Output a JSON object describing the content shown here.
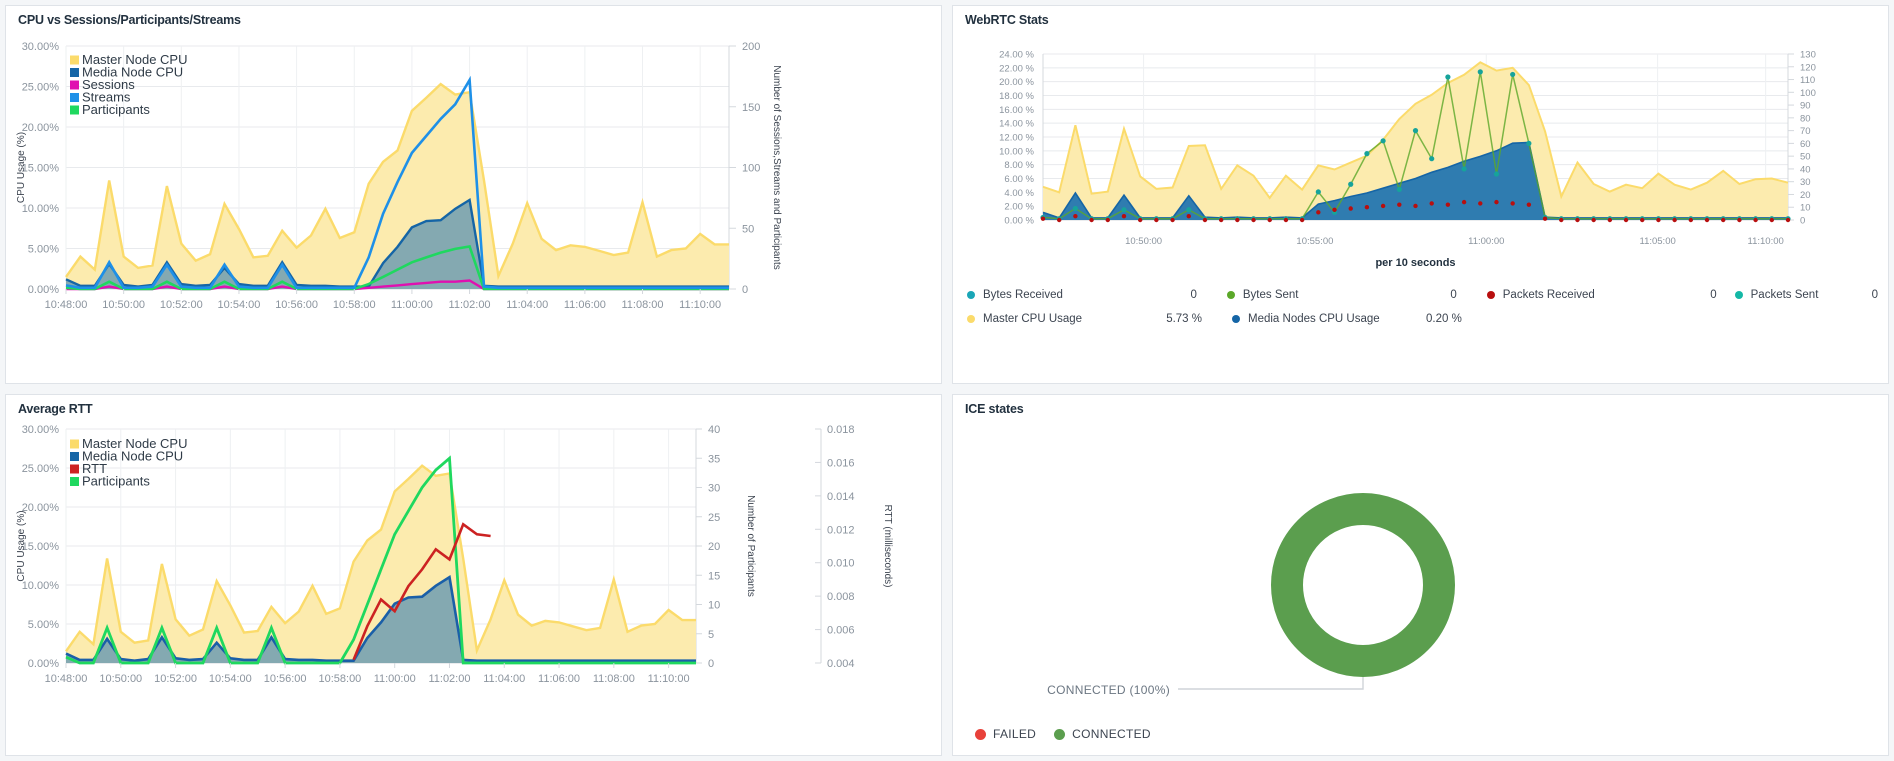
{
  "panels": {
    "cpu_sessions": {
      "title": "CPU vs Sessions/Participants/Streams"
    },
    "webrtc": {
      "title": "WebRTC Stats"
    },
    "avg_rtt": {
      "title": "Average RTT"
    },
    "ice": {
      "title": "ICE states"
    }
  },
  "colors": {
    "master_cpu": "#FBDB6B",
    "master_cpu_fill": "#FCEBAE",
    "media_cpu": "#1565A6",
    "media_cpu_fill": "#6E9EB2",
    "sessions": "#E010B0",
    "streams": "#1E90E8",
    "participants": "#1FD85F",
    "rtt": "#CC2222",
    "bytes_received": "#1AA6B7",
    "bytes_sent": "#5BA829",
    "packets_received": "#B80F0F",
    "packets_sent": "#14B8A6",
    "webrtc_master": "#FBDB6B",
    "webrtc_media": "#1565A6",
    "ice_failed": "#E8413A",
    "ice_connected": "#5B9E4E"
  },
  "chart_data": [
    {
      "id": "cpu_sessions",
      "type": "area",
      "title": "CPU vs Sessions/Participants/Streams",
      "xlabel": "",
      "ylabel": "CPU Usage (%)",
      "y2label": "Number of Sessions,Streams and Participants",
      "ylim": [
        0,
        30
      ],
      "y2lim": [
        0,
        200
      ],
      "yticks": [
        "0.00%",
        "5.00%",
        "10.00%",
        "15.00%",
        "20.00%",
        "25.00%",
        "30.00%"
      ],
      "y2ticks": [
        "0",
        "50",
        "100",
        "150",
        "200"
      ],
      "xticks": [
        "10:48:00",
        "10:50:00",
        "10:52:00",
        "10:54:00",
        "10:56:00",
        "10:58:00",
        "11:00:00",
        "11:02:00",
        "11:04:00",
        "11:06:00",
        "11:08:00",
        "11:10:00"
      ],
      "legend": [
        {
          "label": "Master Node CPU",
          "color": "#FBDB6B"
        },
        {
          "label": "Media Node CPU",
          "color": "#1565A6"
        },
        {
          "label": "Sessions",
          "color": "#E010B0"
        },
        {
          "label": "Streams",
          "color": "#1E90E8"
        },
        {
          "label": "Participants",
          "color": "#1FD85F"
        }
      ],
      "series": [
        {
          "name": "Master Node CPU",
          "axis": "left",
          "values": [
            1.5,
            4.0,
            2.4,
            13.4,
            4.0,
            2.6,
            2.9,
            12.7,
            5.6,
            3.5,
            4.3,
            10.5,
            7.4,
            3.9,
            4.1,
            7.2,
            5.1,
            6.6,
            9.9,
            6.3,
            7.0,
            13.0,
            15.7,
            17.1,
            22.0,
            23.6,
            25.3,
            24.0,
            24.3,
            13.4,
            1.6,
            5.6,
            10.6,
            6.2,
            4.8,
            5.4,
            5.2,
            4.7,
            4.2,
            4.5,
            10.7,
            4.0,
            4.8,
            5.0,
            6.8,
            5.5,
            5.5
          ]
        },
        {
          "name": "Media Node CPU",
          "axis": "left",
          "values": [
            1.2,
            0.4,
            0.4,
            3.1,
            0.5,
            0.3,
            0.5,
            3.3,
            0.6,
            0.4,
            0.5,
            2.6,
            0.6,
            0.4,
            0.4,
            3.3,
            0.5,
            0.4,
            0.4,
            0.3,
            0.3,
            0.3,
            3.2,
            5.2,
            7.6,
            8.4,
            8.5,
            9.9,
            11.0,
            0.4,
            0.3,
            0.3,
            0.3,
            0.3,
            0.3,
            0.3,
            0.3,
            0.3,
            0.3,
            0.3,
            0.3,
            0.3,
            0.3,
            0.3,
            0.3,
            0.3,
            0.3
          ]
        },
        {
          "name": "Sessions",
          "axis": "right",
          "values": [
            0,
            0,
            0,
            2,
            0,
            0,
            0,
            2,
            0,
            0,
            0,
            2,
            0,
            0,
            0,
            2,
            0,
            0,
            0,
            0,
            0,
            1,
            2,
            3,
            4,
            5,
            6,
            6,
            7,
            0,
            0,
            0,
            0,
            0,
            0,
            0,
            0,
            0,
            0,
            0,
            0,
            0,
            0,
            0,
            0,
            0,
            0
          ]
        },
        {
          "name": "Streams",
          "axis": "right",
          "values": [
            3,
            1,
            1,
            22,
            1,
            1,
            2,
            20,
            2,
            1,
            1,
            20,
            2,
            1,
            1,
            20,
            1,
            1,
            1,
            1,
            1,
            26,
            62,
            88,
            112,
            126,
            140,
            152,
            172,
            2,
            1,
            1,
            1,
            1,
            1,
            1,
            1,
            1,
            1,
            1,
            1,
            1,
            1,
            1,
            1,
            1,
            1
          ]
        },
        {
          "name": "Participants",
          "axis": "right",
          "values": [
            1,
            0,
            0,
            6,
            0,
            0,
            0,
            6,
            0,
            0,
            0,
            6,
            0,
            0,
            0,
            6,
            0,
            0,
            0,
            0,
            0,
            4,
            10,
            16,
            22,
            26,
            30,
            33,
            35,
            0,
            0,
            0,
            0,
            0,
            0,
            0,
            0,
            0,
            0,
            0,
            0,
            0,
            0,
            0,
            0,
            0,
            0
          ]
        }
      ]
    },
    {
      "id": "webrtc",
      "type": "area",
      "title": "WebRTC Stats",
      "xlabel": "per 10 seconds",
      "ylabel": "",
      "ylim": [
        0,
        24
      ],
      "y2lim": [
        0,
        130
      ],
      "yticks": [
        "0.00 %",
        "2.00 %",
        "4.00 %",
        "6.00 %",
        "8.00 %",
        "10.00 %",
        "12.00 %",
        "14.00 %",
        "16.00 %",
        "18.00 %",
        "20.00 %",
        "22.00 %",
        "24.00 %"
      ],
      "y2ticks": [
        "0",
        "10",
        "20",
        "30",
        "40",
        "50",
        "60",
        "70",
        "80",
        "90",
        "100",
        "110",
        "120",
        "130"
      ],
      "xticks": [
        "10:50:00",
        "10:55:00",
        "11:00:00",
        "11:05:00",
        "11:10:00"
      ],
      "legend": [
        {
          "label": "Bytes Received",
          "value": "0",
          "color": "#1AA6B7"
        },
        {
          "label": "Bytes Sent",
          "value": "0",
          "color": "#5BA829"
        },
        {
          "label": "Packets Received",
          "value": "0",
          "color": "#B80F0F"
        },
        {
          "label": "Packets Sent",
          "value": "0",
          "color": "#14B8A6"
        },
        {
          "label": "Master CPU Usage",
          "value": "5.73 %",
          "color": "#FBDB6B"
        },
        {
          "label": "Media Nodes CPU Usage",
          "value": "0.20 %",
          "color": "#1565A6"
        }
      ],
      "series": [
        {
          "name": "Master CPU Usage",
          "axis": "left",
          "values": [
            4.8,
            4.0,
            13.7,
            3.8,
            4.1,
            13.2,
            6.3,
            4.5,
            4.7,
            10.7,
            10.8,
            4.5,
            7.9,
            6.4,
            3.2,
            6.4,
            4.4,
            7.9,
            7.3,
            8.3,
            9.3,
            11.6,
            14.6,
            16.8,
            18.1,
            19.8,
            21.0,
            22.8,
            21.6,
            22.0,
            19.5,
            12.8,
            3.4,
            8.3,
            5.2,
            4.1,
            5.1,
            4.6,
            6.7,
            5.1,
            4.4,
            5.4,
            7.1,
            5.2,
            5.9,
            6.0,
            5.4
          ]
        },
        {
          "name": "Media Nodes CPU Usage",
          "axis": "left",
          "values": [
            1.1,
            0.3,
            3.9,
            0.3,
            0.3,
            3.6,
            0.3,
            0.3,
            0.3,
            3.5,
            0.4,
            0.3,
            0.4,
            0.3,
            0.3,
            0.4,
            0.3,
            2.3,
            2.8,
            3.4,
            3.9,
            4.6,
            5.3,
            6.0,
            6.9,
            7.6,
            8.5,
            9.2,
            10.0,
            11.1,
            11.2,
            0.4,
            0.3,
            0.3,
            0.3,
            0.3,
            0.3,
            0.3,
            0.3,
            0.3,
            0.3,
            0.3,
            0.3,
            0.3,
            0.3,
            0.3,
            0.3
          ]
        },
        {
          "name": "Packets Sent",
          "axis": "right",
          "values": [
            2,
            1,
            9,
            1,
            1,
            8,
            1,
            1,
            1,
            8,
            1,
            1,
            1,
            1,
            1,
            1,
            1,
            22,
            6,
            28,
            52,
            62,
            24,
            70,
            48,
            112,
            40,
            116,
            36,
            114,
            60,
            2,
            1,
            1,
            1,
            1,
            1,
            1,
            1,
            1,
            1,
            1,
            1,
            1,
            1,
            1,
            1
          ]
        },
        {
          "name": "Packets Received",
          "axis": "right",
          "values": [
            1,
            0,
            3,
            0,
            0,
            3,
            0,
            0,
            0,
            3,
            0,
            0,
            0,
            0,
            0,
            0,
            0,
            6,
            8,
            9,
            10,
            11,
            12,
            11,
            13,
            12,
            14,
            13,
            14,
            13,
            12,
            1,
            0,
            0,
            0,
            0,
            0,
            0,
            0,
            0,
            0,
            0,
            0,
            0,
            0,
            0,
            0
          ]
        }
      ]
    },
    {
      "id": "avg_rtt",
      "type": "area",
      "title": "Average RTT",
      "xlabel": "",
      "ylabel": "CPU Usage (%)",
      "y2label": "Number of Participants",
      "y3label": "RTT (milliseconds)",
      "ylim": [
        0,
        30
      ],
      "y2lim": [
        0,
        40
      ],
      "y3lim": [
        0.004,
        0.018
      ],
      "yticks": [
        "0.00%",
        "5.00%",
        "10.00%",
        "15.00%",
        "20.00%",
        "25.00%",
        "30.00%"
      ],
      "y2ticks": [
        "0",
        "5",
        "10",
        "15",
        "20",
        "25",
        "30",
        "35",
        "40"
      ],
      "y3ticks": [
        "0.004",
        "0.006",
        "0.008",
        "0.010",
        "0.012",
        "0.014",
        "0.016",
        "0.018"
      ],
      "xticks": [
        "10:48:00",
        "10:50:00",
        "10:52:00",
        "10:54:00",
        "10:56:00",
        "10:58:00",
        "11:00:00",
        "11:02:00",
        "11:04:00",
        "11:06:00",
        "11:08:00",
        "11:10:00"
      ],
      "legend": [
        {
          "label": "Master Node CPU",
          "color": "#FBDB6B"
        },
        {
          "label": "Media Node CPU",
          "color": "#1565A6"
        },
        {
          "label": "RTT",
          "color": "#CC2222"
        },
        {
          "label": "Participants",
          "color": "#1FD85F"
        }
      ],
      "series": [
        {
          "name": "Master Node CPU",
          "axis": "left",
          "values": [
            1.5,
            4.0,
            2.4,
            13.4,
            4.0,
            2.6,
            2.9,
            12.7,
            5.6,
            3.5,
            4.3,
            10.5,
            7.4,
            3.9,
            4.1,
            7.2,
            5.1,
            6.6,
            9.9,
            6.3,
            7.0,
            13.0,
            15.7,
            17.1,
            22.0,
            23.6,
            25.3,
            24.0,
            24.3,
            13.4,
            1.6,
            5.6,
            10.6,
            6.2,
            4.8,
            5.4,
            5.2,
            4.7,
            4.2,
            4.5,
            10.7,
            4.0,
            4.8,
            5.0,
            6.8,
            5.5,
            5.5
          ]
        },
        {
          "name": "Media Node CPU",
          "axis": "left",
          "values": [
            1.2,
            0.4,
            0.4,
            3.1,
            0.5,
            0.3,
            0.5,
            3.3,
            0.6,
            0.4,
            0.5,
            2.6,
            0.6,
            0.4,
            0.4,
            3.3,
            0.5,
            0.4,
            0.4,
            0.3,
            0.3,
            0.3,
            3.2,
            5.2,
            7.6,
            8.4,
            8.5,
            9.9,
            11.0,
            0.4,
            0.3,
            0.3,
            0.3,
            0.3,
            0.3,
            0.3,
            0.3,
            0.3,
            0.3,
            0.3,
            0.3,
            0.3,
            0.3,
            0.3,
            0.3,
            0.3,
            0.3
          ]
        },
        {
          "name": "Participants",
          "axis": "participants",
          "values": [
            1,
            0,
            0,
            6,
            0,
            0,
            0,
            6,
            0,
            0,
            0,
            6,
            0,
            0,
            0,
            6,
            0,
            0,
            0,
            0,
            0,
            4,
            10,
            16,
            22,
            26,
            30,
            33,
            35,
            0,
            0,
            0,
            0,
            0,
            0,
            0,
            0,
            0,
            0,
            0,
            0,
            0,
            0,
            0,
            0,
            0,
            0
          ]
        },
        {
          "name": "RTT",
          "axis": "rtt",
          "start_index": 21,
          "values": [
            0.0042,
            0.0062,
            0.0078,
            0.0071,
            0.0086,
            0.0096,
            0.0108,
            0.0102,
            0.0123,
            0.0117,
            0.0116
          ]
        }
      ]
    },
    {
      "id": "ice",
      "type": "pie",
      "title": "ICE states",
      "slices": [
        {
          "label": "CONNECTED",
          "value": 100,
          "color": "#5B9E4E"
        }
      ],
      "callout": "CONNECTED (100%)",
      "legend": [
        {
          "label": "FAILED",
          "color": "#E8413A"
        },
        {
          "label": "CONNECTED",
          "color": "#5B9E4E"
        }
      ]
    }
  ]
}
